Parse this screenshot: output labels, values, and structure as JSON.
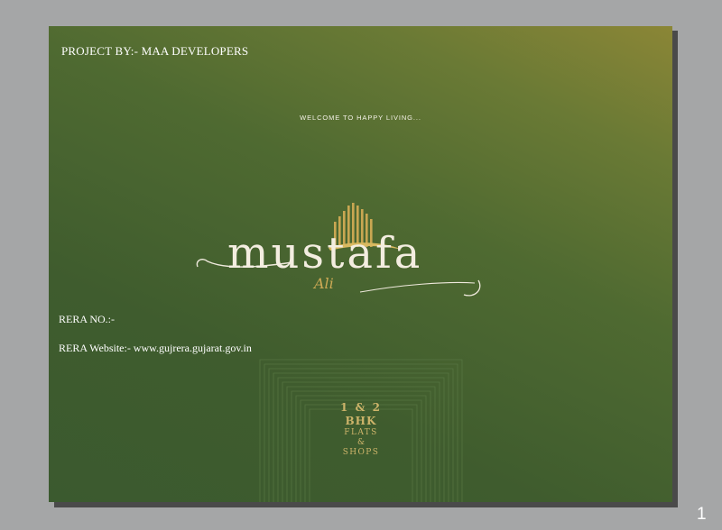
{
  "document": {
    "project_by": "PROJECT BY:- MAA DEVELOPERS",
    "tagline": "WELCOME TO HAPPY LIVING...",
    "logo": {
      "name": "mustafa",
      "sub": "Ali",
      "icon": "building-skyline-icon",
      "accent_color": "#cdaa55"
    },
    "rera_no": "RERA NO.:-",
    "rera_website": "RERA Website:- www.gujrera.gujarat.gov.in",
    "offer": {
      "line1": "1 & 2",
      "line2": "BHK",
      "line3": "FLATS",
      "line4": "&",
      "line5": "SHOPS"
    },
    "page_number": "1"
  },
  "colors": {
    "background": "#a5a6a7",
    "page_green": "#3f5c2e",
    "page_olive": "#8b8636",
    "gold": "#cdb46a"
  }
}
